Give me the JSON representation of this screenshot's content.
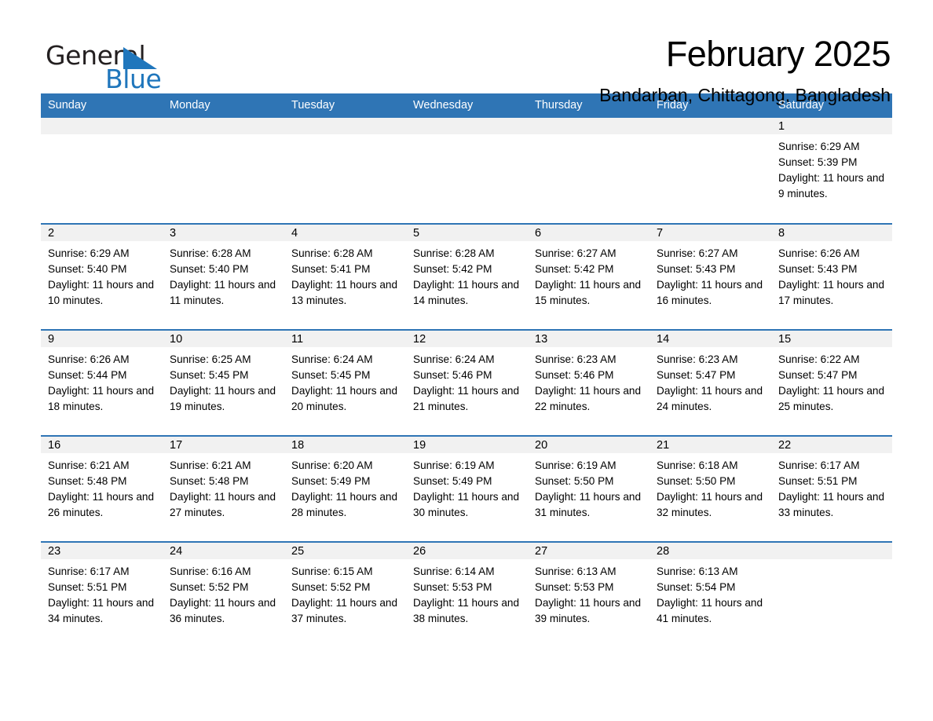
{
  "brand": {
    "name_part1": "General",
    "name_part2": "Blue",
    "triangle_color": "#1f76bc"
  },
  "header": {
    "month_title": "February 2025",
    "location": "Bandarban, Chittagong, Bangladesh"
  },
  "theme": {
    "header_blue": "#2f75b5",
    "daynum_band": "#f1f1f1",
    "text": "#000000"
  },
  "calendar": {
    "weekday_headers": [
      "Sunday",
      "Monday",
      "Tuesday",
      "Wednesday",
      "Thursday",
      "Friday",
      "Saturday"
    ],
    "weeks": [
      [
        {
          "day": "",
          "sunrise": "",
          "sunset": "",
          "daylight": ""
        },
        {
          "day": "",
          "sunrise": "",
          "sunset": "",
          "daylight": ""
        },
        {
          "day": "",
          "sunrise": "",
          "sunset": "",
          "daylight": ""
        },
        {
          "day": "",
          "sunrise": "",
          "sunset": "",
          "daylight": ""
        },
        {
          "day": "",
          "sunrise": "",
          "sunset": "",
          "daylight": ""
        },
        {
          "day": "",
          "sunrise": "",
          "sunset": "",
          "daylight": ""
        },
        {
          "day": "1",
          "sunrise": "Sunrise: 6:29 AM",
          "sunset": "Sunset: 5:39 PM",
          "daylight": "Daylight: 11 hours and 9 minutes."
        }
      ],
      [
        {
          "day": "2",
          "sunrise": "Sunrise: 6:29 AM",
          "sunset": "Sunset: 5:40 PM",
          "daylight": "Daylight: 11 hours and 10 minutes."
        },
        {
          "day": "3",
          "sunrise": "Sunrise: 6:28 AM",
          "sunset": "Sunset: 5:40 PM",
          "daylight": "Daylight: 11 hours and 11 minutes."
        },
        {
          "day": "4",
          "sunrise": "Sunrise: 6:28 AM",
          "sunset": "Sunset: 5:41 PM",
          "daylight": "Daylight: 11 hours and 13 minutes."
        },
        {
          "day": "5",
          "sunrise": "Sunrise: 6:28 AM",
          "sunset": "Sunset: 5:42 PM",
          "daylight": "Daylight: 11 hours and 14 minutes."
        },
        {
          "day": "6",
          "sunrise": "Sunrise: 6:27 AM",
          "sunset": "Sunset: 5:42 PM",
          "daylight": "Daylight: 11 hours and 15 minutes."
        },
        {
          "day": "7",
          "sunrise": "Sunrise: 6:27 AM",
          "sunset": "Sunset: 5:43 PM",
          "daylight": "Daylight: 11 hours and 16 minutes."
        },
        {
          "day": "8",
          "sunrise": "Sunrise: 6:26 AM",
          "sunset": "Sunset: 5:43 PM",
          "daylight": "Daylight: 11 hours and 17 minutes."
        }
      ],
      [
        {
          "day": "9",
          "sunrise": "Sunrise: 6:26 AM",
          "sunset": "Sunset: 5:44 PM",
          "daylight": "Daylight: 11 hours and 18 minutes."
        },
        {
          "day": "10",
          "sunrise": "Sunrise: 6:25 AM",
          "sunset": "Sunset: 5:45 PM",
          "daylight": "Daylight: 11 hours and 19 minutes."
        },
        {
          "day": "11",
          "sunrise": "Sunrise: 6:24 AM",
          "sunset": "Sunset: 5:45 PM",
          "daylight": "Daylight: 11 hours and 20 minutes."
        },
        {
          "day": "12",
          "sunrise": "Sunrise: 6:24 AM",
          "sunset": "Sunset: 5:46 PM",
          "daylight": "Daylight: 11 hours and 21 minutes."
        },
        {
          "day": "13",
          "sunrise": "Sunrise: 6:23 AM",
          "sunset": "Sunset: 5:46 PM",
          "daylight": "Daylight: 11 hours and 22 minutes."
        },
        {
          "day": "14",
          "sunrise": "Sunrise: 6:23 AM",
          "sunset": "Sunset: 5:47 PM",
          "daylight": "Daylight: 11 hours and 24 minutes."
        },
        {
          "day": "15",
          "sunrise": "Sunrise: 6:22 AM",
          "sunset": "Sunset: 5:47 PM",
          "daylight": "Daylight: 11 hours and 25 minutes."
        }
      ],
      [
        {
          "day": "16",
          "sunrise": "Sunrise: 6:21 AM",
          "sunset": "Sunset: 5:48 PM",
          "daylight": "Daylight: 11 hours and 26 minutes."
        },
        {
          "day": "17",
          "sunrise": "Sunrise: 6:21 AM",
          "sunset": "Sunset: 5:48 PM",
          "daylight": "Daylight: 11 hours and 27 minutes."
        },
        {
          "day": "18",
          "sunrise": "Sunrise: 6:20 AM",
          "sunset": "Sunset: 5:49 PM",
          "daylight": "Daylight: 11 hours and 28 minutes."
        },
        {
          "day": "19",
          "sunrise": "Sunrise: 6:19 AM",
          "sunset": "Sunset: 5:49 PM",
          "daylight": "Daylight: 11 hours and 30 minutes."
        },
        {
          "day": "20",
          "sunrise": "Sunrise: 6:19 AM",
          "sunset": "Sunset: 5:50 PM",
          "daylight": "Daylight: 11 hours and 31 minutes."
        },
        {
          "day": "21",
          "sunrise": "Sunrise: 6:18 AM",
          "sunset": "Sunset: 5:50 PM",
          "daylight": "Daylight: 11 hours and 32 minutes."
        },
        {
          "day": "22",
          "sunrise": "Sunrise: 6:17 AM",
          "sunset": "Sunset: 5:51 PM",
          "daylight": "Daylight: 11 hours and 33 minutes."
        }
      ],
      [
        {
          "day": "23",
          "sunrise": "Sunrise: 6:17 AM",
          "sunset": "Sunset: 5:51 PM",
          "daylight": "Daylight: 11 hours and 34 minutes."
        },
        {
          "day": "24",
          "sunrise": "Sunrise: 6:16 AM",
          "sunset": "Sunset: 5:52 PM",
          "daylight": "Daylight: 11 hours and 36 minutes."
        },
        {
          "day": "25",
          "sunrise": "Sunrise: 6:15 AM",
          "sunset": "Sunset: 5:52 PM",
          "daylight": "Daylight: 11 hours and 37 minutes."
        },
        {
          "day": "26",
          "sunrise": "Sunrise: 6:14 AM",
          "sunset": "Sunset: 5:53 PM",
          "daylight": "Daylight: 11 hours and 38 minutes."
        },
        {
          "day": "27",
          "sunrise": "Sunrise: 6:13 AM",
          "sunset": "Sunset: 5:53 PM",
          "daylight": "Daylight: 11 hours and 39 minutes."
        },
        {
          "day": "28",
          "sunrise": "Sunrise: 6:13 AM",
          "sunset": "Sunset: 5:54 PM",
          "daylight": "Daylight: 11 hours and 41 minutes."
        },
        {
          "day": "",
          "sunrise": "",
          "sunset": "",
          "daylight": ""
        }
      ]
    ]
  }
}
